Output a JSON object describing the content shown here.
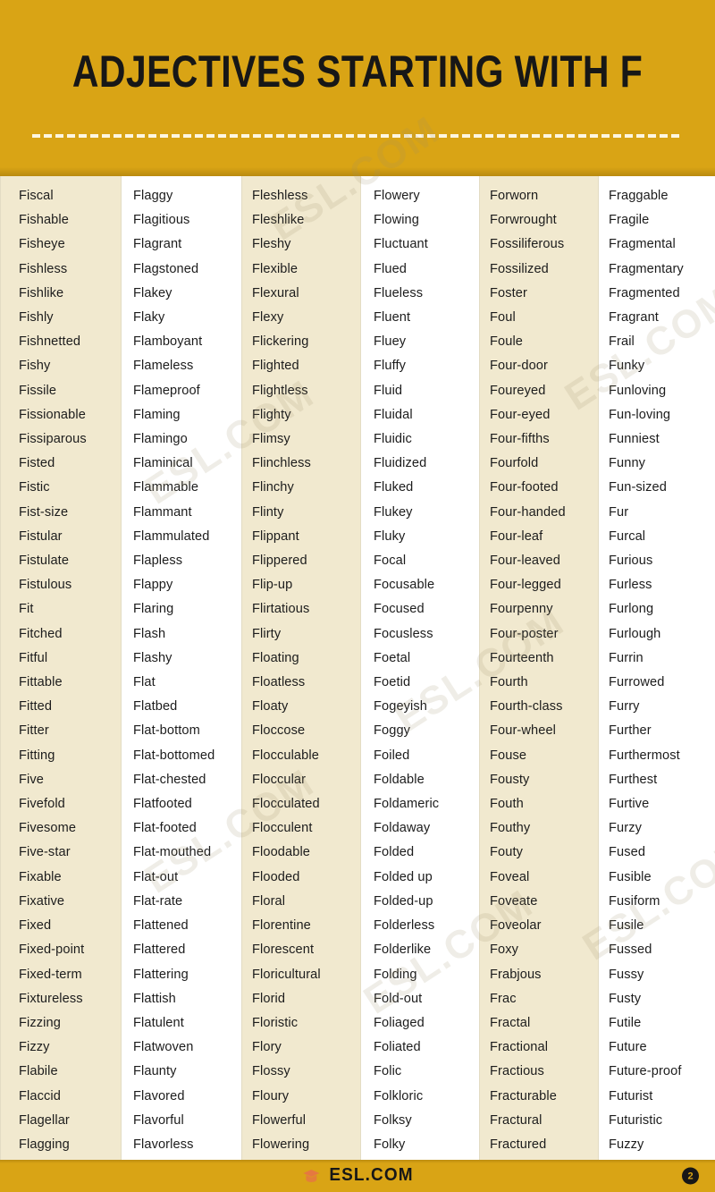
{
  "header": {
    "title": "ADJECTIVES STARTING WITH F",
    "divider": "dashed-rule"
  },
  "theme": {
    "accent": "#d9a415",
    "tinted_column_bg": "#f1e9cf",
    "plain_column_bg": "#ffffff",
    "text": "#1c1c1c"
  },
  "watermarks": [
    "ESL.COM",
    "ESL.COM",
    "ESL.COM",
    "ESL.COM",
    "ESL.COM",
    "ESL.COM",
    "ESL.COM"
  ],
  "columns": [
    {
      "index": 1,
      "shaded": true,
      "words": [
        "Fiscal",
        "Fishable",
        "Fisheye",
        "Fishless",
        "Fishlike",
        "Fishly",
        "Fishnetted",
        "Fishy",
        "Fissile",
        "Fissionable",
        "Fissiparous",
        "Fisted",
        "Fistic",
        "Fist-size",
        "Fistular",
        "Fistulate",
        "Fistulous",
        "Fit",
        "Fitched",
        "Fitful",
        "Fittable",
        "Fitted",
        "Fitter",
        "Fitting",
        "Five",
        "Fivefold",
        "Fivesome",
        "Five-star",
        "Fixable",
        "Fixative",
        "Fixed",
        "Fixed-point",
        "Fixed-term",
        "Fixtureless",
        "Fizzing",
        "Fizzy",
        "Flabile",
        "Flaccid",
        "Flagellar",
        "Flagging"
      ]
    },
    {
      "index": 2,
      "shaded": false,
      "words": [
        "Flaggy",
        "Flagitious",
        "Flagrant",
        "Flagstoned",
        "Flakey",
        "Flaky",
        "Flamboyant",
        "Flameless",
        "Flameproof",
        "Flaming",
        "Flamingo",
        "Flaminical",
        "Flammable",
        "Flammant",
        "Flammulated",
        "Flapless",
        "Flappy",
        "Flaring",
        "Flash",
        "Flashy",
        "Flat",
        "Flatbed",
        "Flat-bottom",
        "Flat-bottomed",
        "Flat-chested",
        "Flatfooted",
        "Flat-footed",
        "Flat-mouthed",
        "Flat-out",
        "Flat-rate",
        "Flattened",
        "Flattered",
        "Flattering",
        "Flattish",
        "Flatulent",
        "Flatwoven",
        "Flaunty",
        "Flavored",
        "Flavorful",
        "Flavorless"
      ]
    },
    {
      "index": 3,
      "shaded": true,
      "words": [
        "Fleshless",
        "Fleshlike",
        "Fleshy",
        "Flexible",
        "Flexural",
        "Flexy",
        "Flickering",
        "Flighted",
        "Flightless",
        "Flighty",
        "Flimsy",
        "Flinchless",
        "Flinchy",
        "Flinty",
        "Flippant",
        "Flippered",
        "Flip-up",
        "Flirtatious",
        "Flirty",
        "Floating",
        "Floatless",
        "Floaty",
        "Floccose",
        "Flocculable",
        "Floccular",
        "Flocculated",
        "Flocculent",
        "Floodable",
        "Flooded",
        "Floral",
        "Florentine",
        "Florescent",
        "Floricultural",
        "Florid",
        "Floristic",
        "Flory",
        "Flossy",
        "Floury",
        "Flowerful",
        "Flowering"
      ]
    },
    {
      "index": 4,
      "shaded": false,
      "words": [
        "Flowery",
        "Flowing",
        "Fluctuant",
        "Flued",
        "Flueless",
        "Fluent",
        "Fluey",
        "Fluffy",
        "Fluid",
        "Fluidal",
        "Fluidic",
        "Fluidized",
        "Fluked",
        "Flukey",
        "Fluky",
        "Focal",
        "Focusable",
        "Focused",
        "Focusless",
        "Foetal",
        "Foetid",
        "Fogeyish",
        "Foggy",
        "Foiled",
        "Foldable",
        "Foldameric",
        "Foldaway",
        "Folded",
        "Folded up",
        "Folded-up",
        "Folderless",
        "Folderlike",
        "Folding",
        "Fold-out",
        "Foliaged",
        "Foliated",
        "Folic",
        "Folkloric",
        "Folksy",
        "Folky"
      ]
    },
    {
      "index": 5,
      "shaded": true,
      "words": [
        "Forworn",
        "Forwrought",
        "Fossiliferous",
        "Fossilized",
        "Foster",
        "Foul",
        "Foule",
        "Four-door",
        "Foureyed",
        "Four-eyed",
        "Four-fifths",
        "Fourfold",
        "Four-footed",
        "Four-handed",
        "Four-leaf",
        "Four-leaved",
        "Four-legged",
        "Fourpenny",
        "Four-poster",
        "Fourteenth",
        "Fourth",
        "Fourth-class",
        "Four-wheel",
        "Fouse",
        "Fousty",
        "Fouth",
        "Fouthy",
        "Fouty",
        "Foveal",
        "Foveate",
        "Foveolar",
        "Foxy",
        "Frabjous",
        "Frac",
        "Fractal",
        "Fractional",
        "Fractious",
        "Fracturable",
        "Fractural",
        "Fractured"
      ]
    },
    {
      "index": 6,
      "shaded": false,
      "words": [
        "Fraggable",
        "Fragile",
        "Fragmental",
        "Fragmentary",
        "Fragmented",
        "Fragrant",
        "Frail",
        "Funky",
        "Funloving",
        "Fun-loving",
        "Funniest",
        "Funny",
        "Fun-sized",
        "Fur",
        "Furcal",
        "Furious",
        "Furless",
        "Furlong",
        "Furlough",
        "Furrin",
        "Furrowed",
        "Furry",
        "Further",
        "Furthermost",
        "Furthest",
        "Furtive",
        "Furzy",
        "Fused",
        "Fusible",
        "Fusiform",
        "Fusile",
        "Fussed",
        "Fussy",
        "Fusty",
        "Futile",
        "Future",
        "Future-proof",
        "Futurist",
        "Futuristic",
        "Fuzzy"
      ]
    }
  ],
  "footer": {
    "brand": "ESL.COM",
    "logo_icon": "graduation-cap-icon",
    "page_number": "2"
  }
}
